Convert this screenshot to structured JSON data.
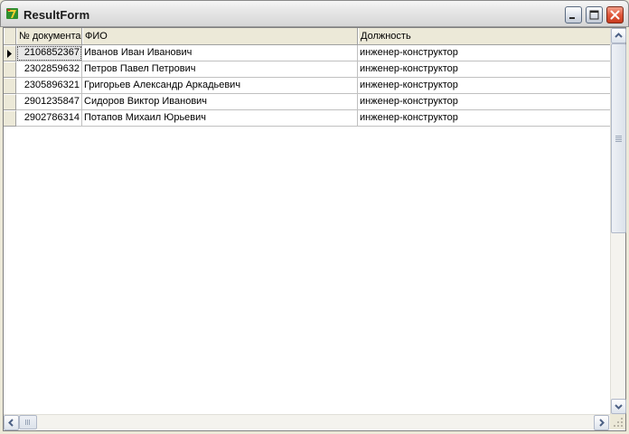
{
  "window": {
    "title": "ResultForm",
    "icon": "delphi-app-icon",
    "controls": [
      "minimize-icon",
      "maximize-icon",
      "close-icon"
    ]
  },
  "grid": {
    "columns": [
      "№ документа",
      "ФИО",
      "Должность"
    ],
    "rows": [
      {
        "doc": "2106852367",
        "name": "Иванов Иван Иванович",
        "position": "инженер-конструктор"
      },
      {
        "doc": "2302859632",
        "name": "Петров Павел Петрович",
        "position": "инженер-конструктор"
      },
      {
        "doc": "2305896321",
        "name": "Григорьев Александр Аркадьевич",
        "position": "инженер-конструктор"
      },
      {
        "doc": "2901235847",
        "name": "Сидоров Виктор Иванович",
        "position": "инженер-конструктор"
      },
      {
        "doc": "2902786314",
        "name": "Потапов Михаил Юрьевич",
        "position": "инженер-конструктор"
      }
    ],
    "current_row_index": 0,
    "current_row_marker": "row-pointer-icon"
  },
  "colors": {
    "close_button": "#e0583c",
    "grid_header": "#ece9d8",
    "window_frame": "#ece9d8"
  }
}
